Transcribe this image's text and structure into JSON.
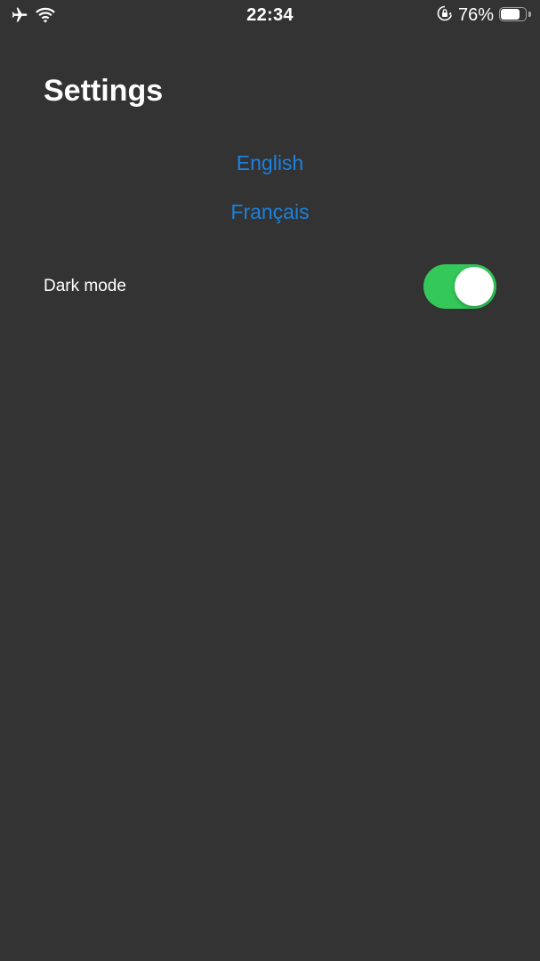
{
  "status_bar": {
    "time": "22:34",
    "battery_percent": "76%",
    "battery_level": 0.76,
    "icons": [
      "airplane-icon",
      "wifi-icon",
      "orientation-lock-icon",
      "battery-icon"
    ]
  },
  "page": {
    "title": "Settings"
  },
  "languages": [
    {
      "label": "English"
    },
    {
      "label": "Français"
    }
  ],
  "settings": {
    "dark_mode": {
      "label": "Dark mode",
      "enabled": true
    }
  },
  "colors": {
    "background": "#333333",
    "link": "#1a82e0",
    "toggle_on": "#34c759",
    "text": "#ffffff"
  }
}
